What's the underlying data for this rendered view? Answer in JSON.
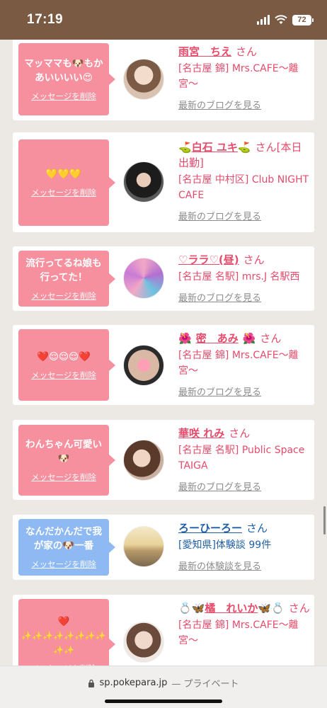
{
  "status": {
    "time": "17:19",
    "battery": "72"
  },
  "feed": {
    "delete_label": "メッセージを削除",
    "san": "さん",
    "blog_link": "最新のブログを見る",
    "review_link": "最新の体験談を見る",
    "cards": [
      {
        "message_a": "マッママも",
        "message_icon_a": "🐶",
        "message_b": "もかあいいいい",
        "message_icon_b": "😍",
        "name": "雨宮　ちえ",
        "shop_a": "[名古屋 錦] Mrs.CAFE〜離宮〜"
      },
      {
        "message_a": "💛💛💛",
        "name_pre": "⛳",
        "name": "白石 ユキ",
        "name_post": "⛳",
        "after_san": "[本日出勤]",
        "shop_a": "[名古屋 中村区] Club NIGHT CAFE"
      },
      {
        "message_a": "流行ってるね娘も行ってた！",
        "name": "♡ララ♡(昼)",
        "shop_a": "[名古屋 名駅] mrs.J 名駅西"
      },
      {
        "message_a": "❤️😌😌😌❤️",
        "name_pre": "🌺",
        "name": "密　あみ",
        "name_post": "🌺",
        "shop_a": "[名古屋 錦] Mrs.CAFE〜離宮〜"
      },
      {
        "message_a": "わんちゃん可愛い",
        "message_icon_a": "🐶",
        "name": "華咲 れみ",
        "shop_a": "[名古屋 名駅] Public Space TAIGA"
      },
      {
        "message_a": "なんだかんだで我が家の",
        "message_icon_a": "🐶",
        "message_b": "一番",
        "name": "ろーひーろー",
        "shop_a": "[愛知県]体験談 99件"
      },
      {
        "message_a": "❤️",
        "message_b": "✨✨✨✨✨✨✨✨✨✨",
        "name_pre": "💍🦋",
        "name": "橘　れいか",
        "name_post": "🦋💍",
        "shop_a": "[名古屋 錦] Mrs.CAFE〜離宮〜"
      }
    ]
  },
  "browser": {
    "domain": "sp.pokepara.jp",
    "privacy": "— プライベート"
  },
  "colors": {
    "pink_bubble": "#f6909f",
    "blue_bubble": "#8fb9f3",
    "name_pink": "#e64b6b",
    "name_blue": "#1f5fa6"
  }
}
